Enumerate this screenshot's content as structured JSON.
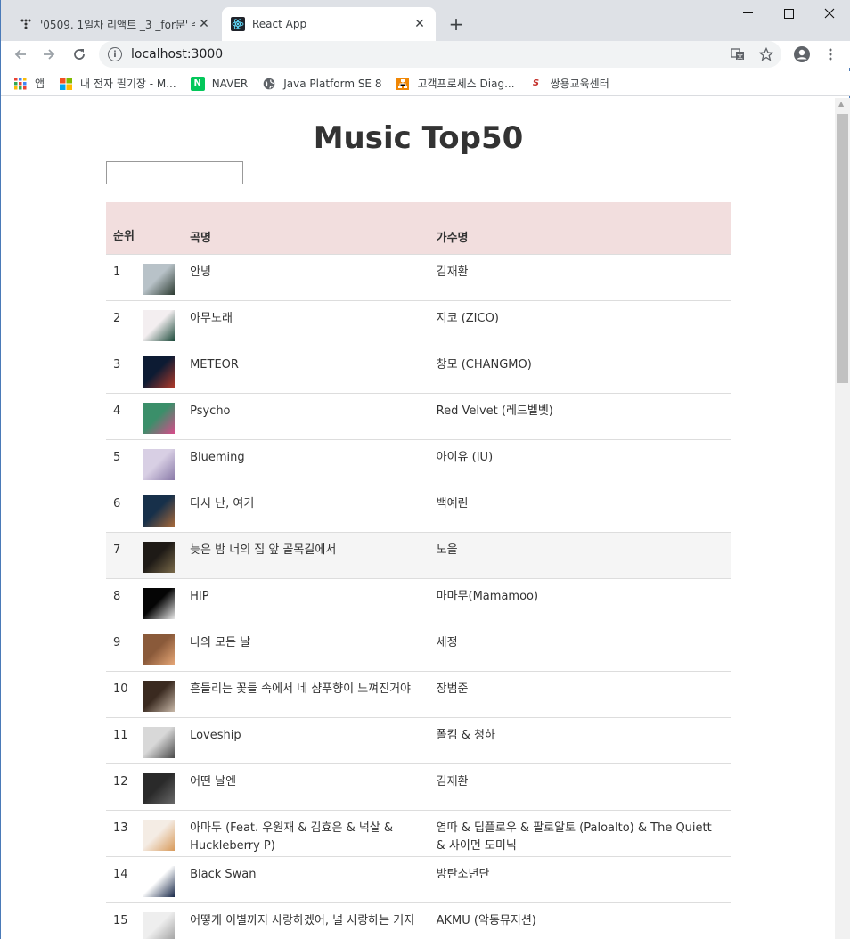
{
  "browser": {
    "tabs": [
      {
        "title": "'0509. 1일차 리액트 _3 _for문' 수",
        "active": false
      },
      {
        "title": "React App",
        "active": true
      }
    ],
    "url": "localhost:3000",
    "bookmarks": [
      {
        "label": "앱",
        "icon": "apps-grid-icon"
      },
      {
        "label": "내 전자 필기장 - M...",
        "icon": "microsoft-logo-icon"
      },
      {
        "label": "NAVER",
        "icon": "naver-logo-icon"
      },
      {
        "label": "Java Platform SE 8",
        "icon": "globe-icon"
      },
      {
        "label": "고객프로세스 Diag...",
        "icon": "diagram-icon"
      },
      {
        "label": "쌍용교육센터",
        "icon": "ss-logo-icon"
      }
    ]
  },
  "page": {
    "title": "Music Top50",
    "search": {
      "value": "",
      "placeholder": ""
    },
    "table": {
      "headers": {
        "rank": "순위",
        "song": "곡명",
        "artist": "가수명"
      },
      "rows": [
        {
          "rank": "1",
          "song": "안녕",
          "artist": "김재환",
          "cover": [
            "#b8c2c8",
            "#2b3a30"
          ]
        },
        {
          "rank": "2",
          "song": "아무노래",
          "artist": "지코 (ZICO)",
          "cover": [
            "#f3eef0",
            "#1c4a3a"
          ]
        },
        {
          "rank": "3",
          "song": "METEOR",
          "artist": "창모 (CHANGMO)",
          "cover": [
            "#0d1b33",
            "#b13a2a"
          ]
        },
        {
          "rank": "4",
          "song": "Psycho",
          "artist": "Red Velvet (레드벨벳)",
          "cover": [
            "#3b8f6a",
            "#d84b8a"
          ]
        },
        {
          "rank": "5",
          "song": "Blueming",
          "artist": "아이유 (IU)",
          "cover": [
            "#d8cfe4",
            "#8a7aa8"
          ]
        },
        {
          "rank": "6",
          "song": "다시 난, 여기",
          "artist": "백예린",
          "cover": [
            "#17304a",
            "#a86a3a"
          ]
        },
        {
          "rank": "7",
          "song": "늦은 밤 너의 집 앞 골목길에서",
          "artist": "노을",
          "cover": [
            "#1e1a16",
            "#7a6a4a"
          ]
        },
        {
          "rank": "8",
          "song": "HIP",
          "artist": "마마무(Mamamoo)",
          "cover": [
            "#050505",
            "#e8e8e8"
          ]
        },
        {
          "rank": "9",
          "song": "나의 모든 날",
          "artist": "세정",
          "cover": [
            "#8a5a3a",
            "#e8a878"
          ]
        },
        {
          "rank": "10",
          "song": "흔들리는 꽃들 속에서 네 샴푸향이 느껴진거야",
          "artist": "장범준",
          "cover": [
            "#3a2a20",
            "#c8b8a8"
          ]
        },
        {
          "rank": "11",
          "song": "Loveship",
          "artist": "폴킴 & 청하",
          "cover": [
            "#d8d8d8",
            "#4a4a4a"
          ]
        },
        {
          "rank": "12",
          "song": "어떤 날엔",
          "artist": "김재환",
          "cover": [
            "#2a2a2a",
            "#6a6a6a"
          ]
        },
        {
          "rank": "13",
          "song": "아마두 (Feat. 우원재 & 김효은 & 넉살 & Huckleberry P)",
          "artist": "염따 & 딥플로우 & 팔로알토 (Paloalto) & The Quiett & 사이먼 도미닉",
          "cover": [
            "#f4ece4",
            "#d89a5a"
          ]
        },
        {
          "rank": "14",
          "song": "Black Swan",
          "artist": "방탄소년단",
          "cover": [
            "#ffffff",
            "#1a2a4a"
          ]
        },
        {
          "rank": "15",
          "song": "어떻게 이별까지 사랑하겠어, 널 사랑하는 거지",
          "artist": "AKMU (악동뮤지션)",
          "cover": [
            "#eeeeee",
            "#9a9a9a"
          ]
        }
      ],
      "highlighted_row": 7
    }
  }
}
